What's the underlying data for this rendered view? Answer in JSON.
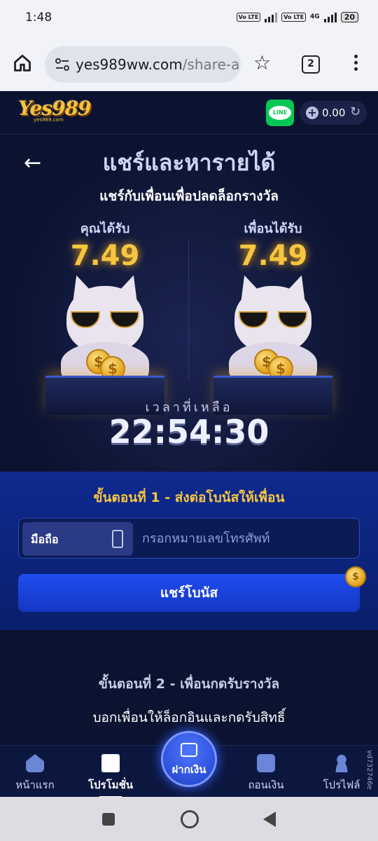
{
  "status_bar": {
    "time": "1:48",
    "volte1": "Vo LTE",
    "volte2": "Vo LTE",
    "network": "4G",
    "battery": "20"
  },
  "browser": {
    "url_main": "yes989ww.com",
    "url_path": "/share-a",
    "tab_count": "2"
  },
  "header": {
    "logo_text": "Yes989",
    "logo_sub": "yes989.com",
    "line_label": "LINE",
    "balance": "0.00"
  },
  "hero": {
    "title": "แชร์และหารายได้",
    "subtitle": "แชร์กับเพื่อนเพื่อปลดล็อกรางวัล",
    "you_label": "คุณได้รับ",
    "you_value": "7.49",
    "friend_label": "เพื่อนได้รับ",
    "friend_value": "7.49",
    "timer_label": "เวลาที่เหลือ",
    "timer": "22:54:30"
  },
  "step1": {
    "title": "ขั้นตอนที่ 1 - ส่งต่อโบนัสให้เพื่อน",
    "phone_tag": "มือถือ",
    "phone_placeholder": "กรอกหมายเลขโทรศัพท์",
    "share_button": "แชร์โบนัส"
  },
  "step2": {
    "title": "ขั้นตอนที่ 2 - เพื่อนกดรับรางวัล",
    "desc": "บอกเพื่อนให้ล็อกอินและกดรับสิทธิ์"
  },
  "bottom_nav": {
    "home": "หน้าแรก",
    "promo": "โปรโมชั่น",
    "deposit": "ฝากเงิน",
    "withdraw": "ถอนเงิน",
    "profile": "โปรไฟล์",
    "version": "vd732746e"
  },
  "colors": {
    "accent_gold": "#f7c63f",
    "primary_blue": "#1f4cf0",
    "bg": "#0c1330",
    "line_green": "#06c755"
  }
}
